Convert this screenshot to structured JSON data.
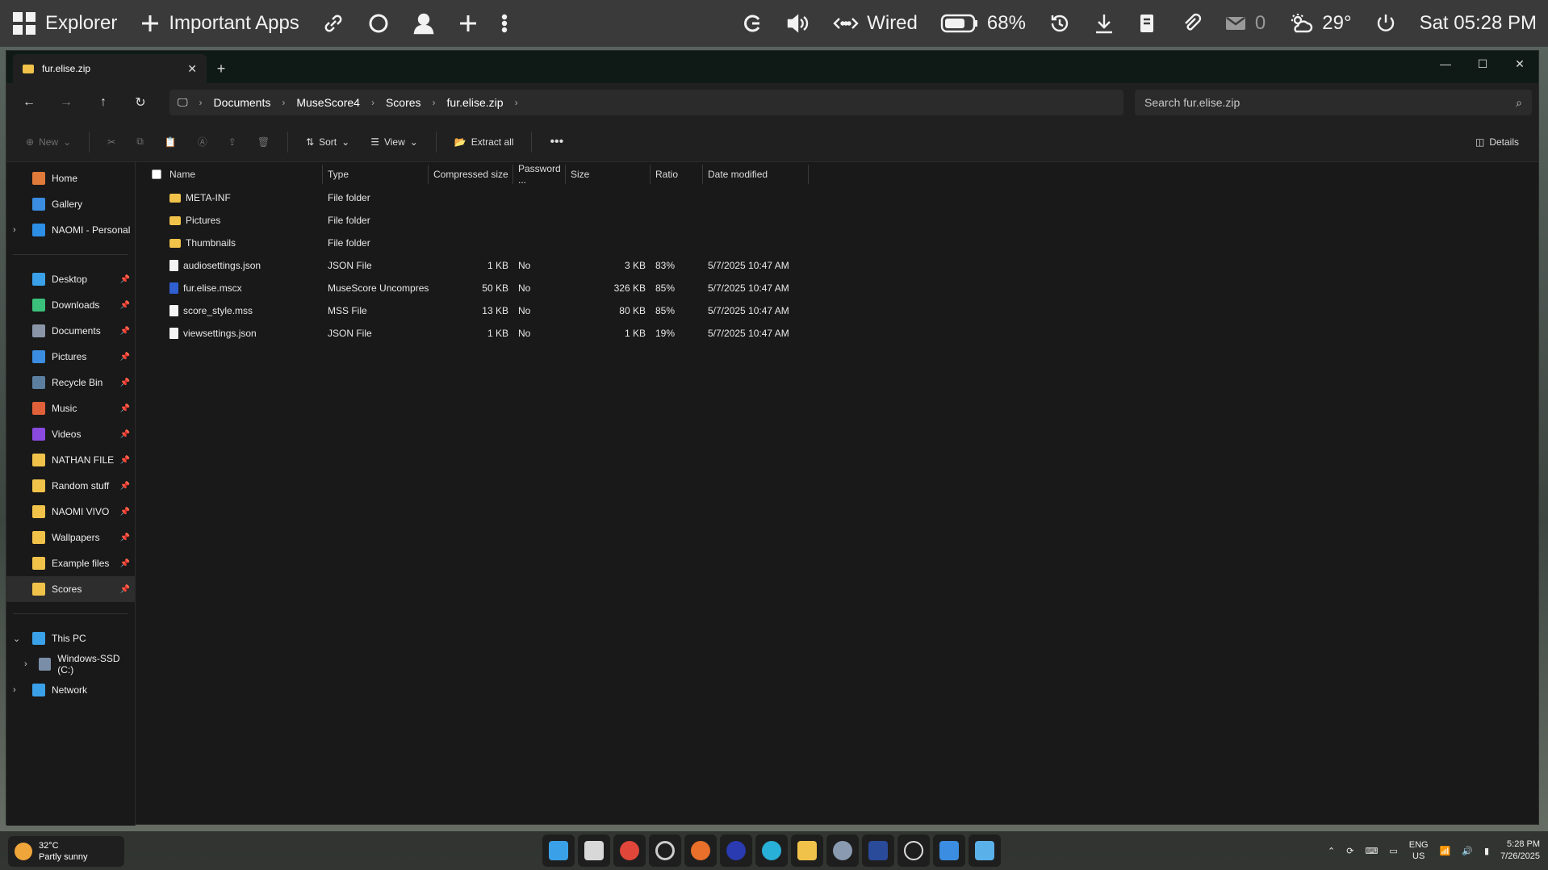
{
  "topbar": {
    "app_name": "Explorer",
    "label_apps": "Important Apps",
    "network": "Wired",
    "battery": "68%",
    "mail_count": "0",
    "temperature": "29°",
    "datetime": "Sat 05:28 PM"
  },
  "window": {
    "tab_title": "fur.elise.zip",
    "breadcrumb": [
      "Documents",
      "MuseScore4",
      "Scores",
      "fur.elise.zip"
    ],
    "search_placeholder": "Search fur.elise.zip"
  },
  "commands": {
    "new": "New",
    "sort": "Sort",
    "view": "View",
    "extract": "Extract all",
    "details": "Details"
  },
  "sidebar": {
    "top": [
      {
        "label": "Home",
        "color": "#e07a3a"
      },
      {
        "label": "Gallery",
        "color": "#3a8de0"
      },
      {
        "label": "NAOMI - Personal",
        "color": "#2d8ee6",
        "expand": true
      }
    ],
    "pinned": [
      {
        "label": "Desktop",
        "color": "#3aa0e8"
      },
      {
        "label": "Downloads",
        "color": "#3ac07a"
      },
      {
        "label": "Documents",
        "color": "#8a96a8"
      },
      {
        "label": "Pictures",
        "color": "#3a8de0"
      },
      {
        "label": "Recycle Bin",
        "color": "#5c7fa0"
      },
      {
        "label": "Music",
        "color": "#e0603a"
      },
      {
        "label": "Videos",
        "color": "#8a4ae0"
      },
      {
        "label": "NATHAN FILE",
        "color": "#f0c24a"
      },
      {
        "label": "Random stuff",
        "color": "#f0c24a"
      },
      {
        "label": "NAOMI VIVO",
        "color": "#f0c24a"
      },
      {
        "label": "Wallpapers",
        "color": "#f0c24a"
      },
      {
        "label": "Example files",
        "color": "#f0c24a"
      },
      {
        "label": "Scores",
        "color": "#f0c24a"
      }
    ],
    "bottom": [
      {
        "label": "This PC",
        "color": "#3aa0e8"
      },
      {
        "label": "Windows-SSD (C:)",
        "color": "#7a8ea8"
      },
      {
        "label": "Network",
        "color": "#3aa0e8"
      }
    ]
  },
  "columns": [
    "Name",
    "Type",
    "Compressed size",
    "Password ...",
    "Size",
    "Ratio",
    "Date modified"
  ],
  "files": [
    {
      "name": "META-INF",
      "type": "File folder",
      "csize": "",
      "pw": "",
      "size": "",
      "ratio": "",
      "date": "",
      "kind": "folder"
    },
    {
      "name": "Pictures",
      "type": "File folder",
      "csize": "",
      "pw": "",
      "size": "",
      "ratio": "",
      "date": "",
      "kind": "folder"
    },
    {
      "name": "Thumbnails",
      "type": "File folder",
      "csize": "",
      "pw": "",
      "size": "",
      "ratio": "",
      "date": "",
      "kind": "folder"
    },
    {
      "name": "audiosettings.json",
      "type": "JSON File",
      "csize": "1 KB",
      "pw": "No",
      "size": "3 KB",
      "ratio": "83%",
      "date": "5/7/2025 10:47 AM",
      "kind": "file"
    },
    {
      "name": "fur.elise.mscx",
      "type": "MuseScore Uncompresse...",
      "csize": "50 KB",
      "pw": "No",
      "size": "326 KB",
      "ratio": "85%",
      "date": "5/7/2025 10:47 AM",
      "kind": "mscx"
    },
    {
      "name": "score_style.mss",
      "type": "MSS File",
      "csize": "13 KB",
      "pw": "No",
      "size": "80 KB",
      "ratio": "85%",
      "date": "5/7/2025 10:47 AM",
      "kind": "file"
    },
    {
      "name": "viewsettings.json",
      "type": "JSON File",
      "csize": "1 KB",
      "pw": "No",
      "size": "1 KB",
      "ratio": "19%",
      "date": "5/7/2025 10:47 AM",
      "kind": "file"
    }
  ],
  "taskbar": {
    "weather_temp": "32°C",
    "weather_desc": "Partly sunny",
    "lang": "ENG",
    "region": "US",
    "time": "5:28 PM",
    "date": "7/26/2025"
  }
}
